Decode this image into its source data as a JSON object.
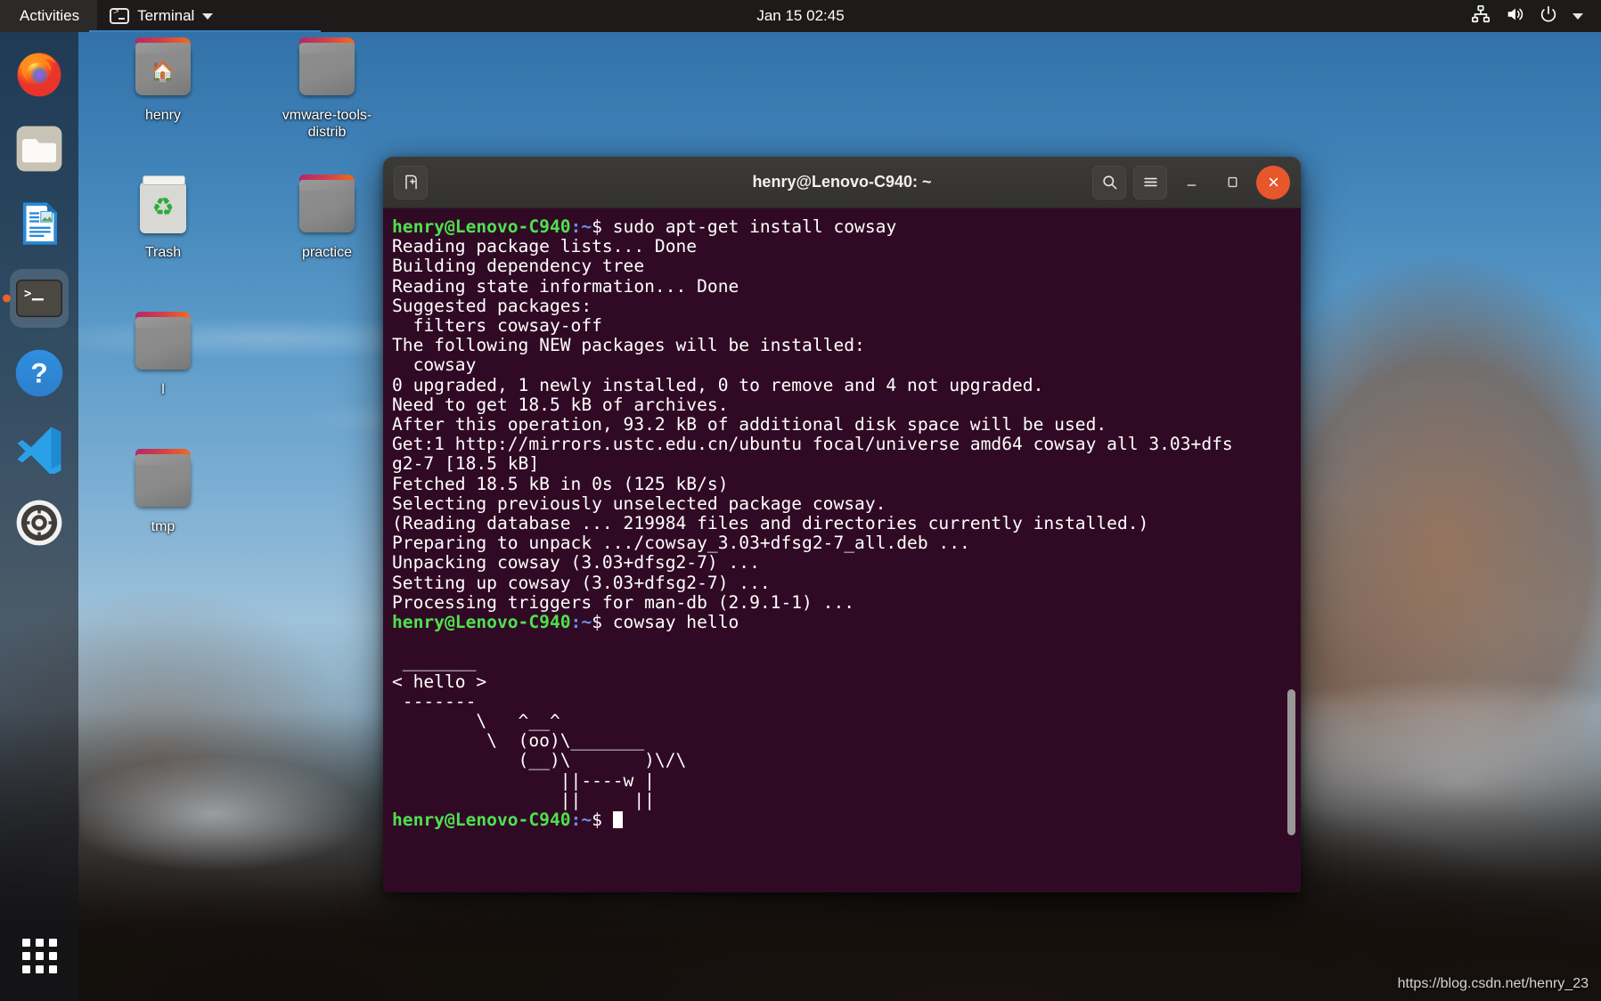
{
  "top_panel": {
    "activities_label": "Activities",
    "app_indicator_label": "Terminal",
    "app_indicator_icon": "terminal-icon",
    "caret_icon": "chevron-down-icon",
    "clock": "Jan 15 02:45",
    "tray": [
      {
        "icon": "network-icon",
        "glyph": "⛓"
      },
      {
        "icon": "volume-icon",
        "glyph": "🔊"
      },
      {
        "icon": "power-icon",
        "glyph": "⏻"
      },
      {
        "icon": "chevron-down-icon",
        "glyph": "▾"
      }
    ]
  },
  "dock": {
    "items": [
      {
        "name": "firefox",
        "label": "Firefox",
        "active": false
      },
      {
        "name": "files",
        "label": "Files",
        "active": false
      },
      {
        "name": "libreoffice-writer",
        "label": "LibreOffice Writer",
        "active": false
      },
      {
        "name": "terminal",
        "label": "Terminal",
        "active": true
      },
      {
        "name": "help",
        "label": "Help",
        "active": false
      },
      {
        "name": "vscode",
        "label": "Visual Studio Code",
        "active": false
      },
      {
        "name": "settings",
        "label": "Settings",
        "active": false
      }
    ],
    "app_grid_label": "Show Applications"
  },
  "desktop_icons": [
    {
      "name": "henry",
      "label": "henry",
      "type": "home-folder"
    },
    {
      "name": "vmware-tools-distrib",
      "label": "vmware-tools-distrib",
      "type": "folder"
    },
    {
      "name": "trash",
      "label": "Trash",
      "type": "trash"
    },
    {
      "name": "practice",
      "label": "practice",
      "type": "folder"
    },
    {
      "name": "l",
      "label": "l",
      "type": "folder"
    },
    {
      "name": "tmp",
      "label": "tmp",
      "type": "folder"
    }
  ],
  "terminal": {
    "title": "henry@Lenovo-C940: ~",
    "new_tab_icon": "new-tab-icon",
    "search_icon": "search-icon",
    "menu_icon": "hamburger-menu-icon",
    "minimize_icon": "minimize-icon",
    "maximize_icon": "maximize-icon",
    "close_icon": "close-icon",
    "background_color": "#300a24",
    "prompt_user_host": "henry@Lenovo-C940",
    "prompt_path": ":~",
    "prompt_sigil": "$ ",
    "command_1": "sudo apt-get install cowsay",
    "command_2": "cowsay hello",
    "output_block_1": "Reading package lists... Done\nBuilding dependency tree\nReading state information... Done\nSuggested packages:\n  filters cowsay-off\nThe following NEW packages will be installed:\n  cowsay\n0 upgraded, 1 newly installed, 0 to remove and 4 not upgraded.\nNeed to get 18.5 kB of archives.\nAfter this operation, 93.2 kB of additional disk space will be used.\nGet:1 http://mirrors.ustc.edu.cn/ubuntu focal/universe amd64 cowsay all 3.03+dfs\ng2-7 [18.5 kB]\nFetched 18.5 kB in 0s (125 kB/s)\nSelecting previously unselected package cowsay.\n(Reading database ... 219984 files and directories currently installed.)\nPreparing to unpack .../cowsay_3.03+dfsg2-7_all.deb ...\nUnpacking cowsay (3.03+dfsg2-7) ...\nSetting up cowsay (3.03+dfsg2-7) ...\nProcessing triggers for man-db (2.9.1-1) ...",
    "output_block_2": " _______\n< hello >\n -------\n        \\   ^__^\n         \\  (oo)\\_______\n            (__)\\       )\\/\\\n                ||----w |\n                ||     ||"
  },
  "watermark": "https://blog.csdn.net/henry_23"
}
